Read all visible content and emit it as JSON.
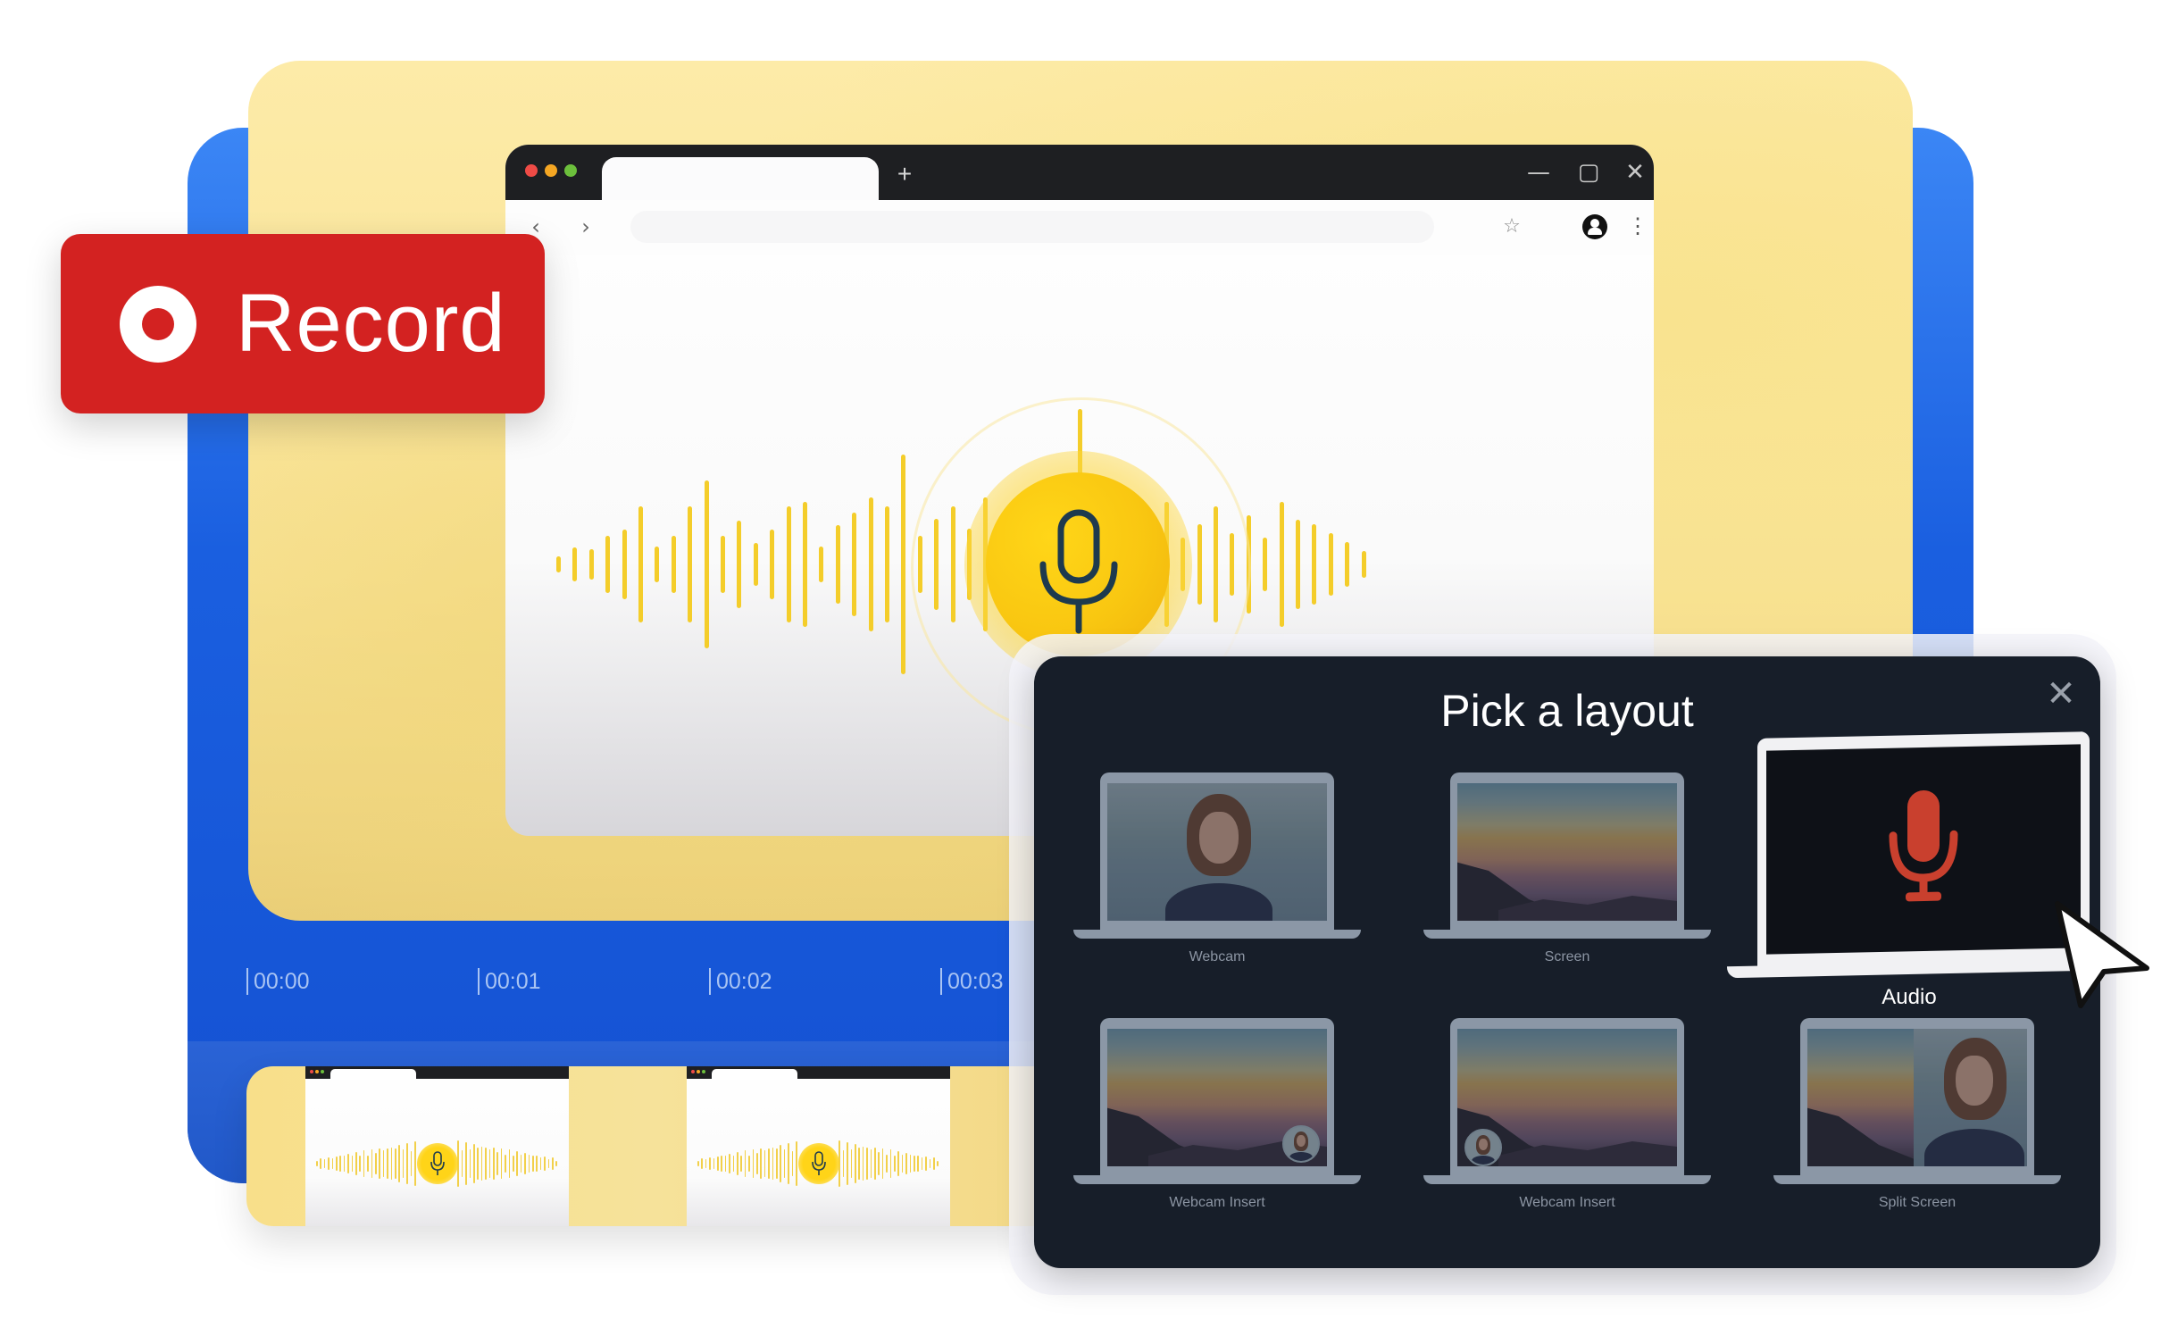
{
  "record_button": {
    "label": "Record",
    "icon": "record-dot-icon"
  },
  "browser": {
    "new_tab_symbol": "+",
    "window_controls": {
      "minimize": "—",
      "maximize": "▢",
      "close": "✕"
    },
    "nav": {
      "back": "‹",
      "forward": "›"
    },
    "bookmark_symbol": "☆",
    "menu_symbol": "⋮",
    "address_text": ""
  },
  "timeline": {
    "ticks": [
      "00:00",
      "00:01",
      "00:02",
      "00:03"
    ]
  },
  "modal": {
    "title": "Pick a layout",
    "close_symbol": "✕",
    "layouts": [
      {
        "label": "Webcam",
        "type": "webcam"
      },
      {
        "label": "Screen",
        "type": "screen"
      },
      {
        "label": "Audio",
        "type": "audio",
        "selected": true
      },
      {
        "label": "Webcam Insert",
        "type": "webcam-insert-right"
      },
      {
        "label": "Webcam Insert",
        "type": "webcam-insert-left"
      },
      {
        "label": "Split Screen",
        "type": "split-screen"
      }
    ]
  },
  "colors": {
    "record_red": "#d32221",
    "brand_blue": "#1a5fe0",
    "mic_yellow": "#f9c711",
    "modal_bg": "#171e29",
    "audio_mic_red": "#c9402e"
  }
}
